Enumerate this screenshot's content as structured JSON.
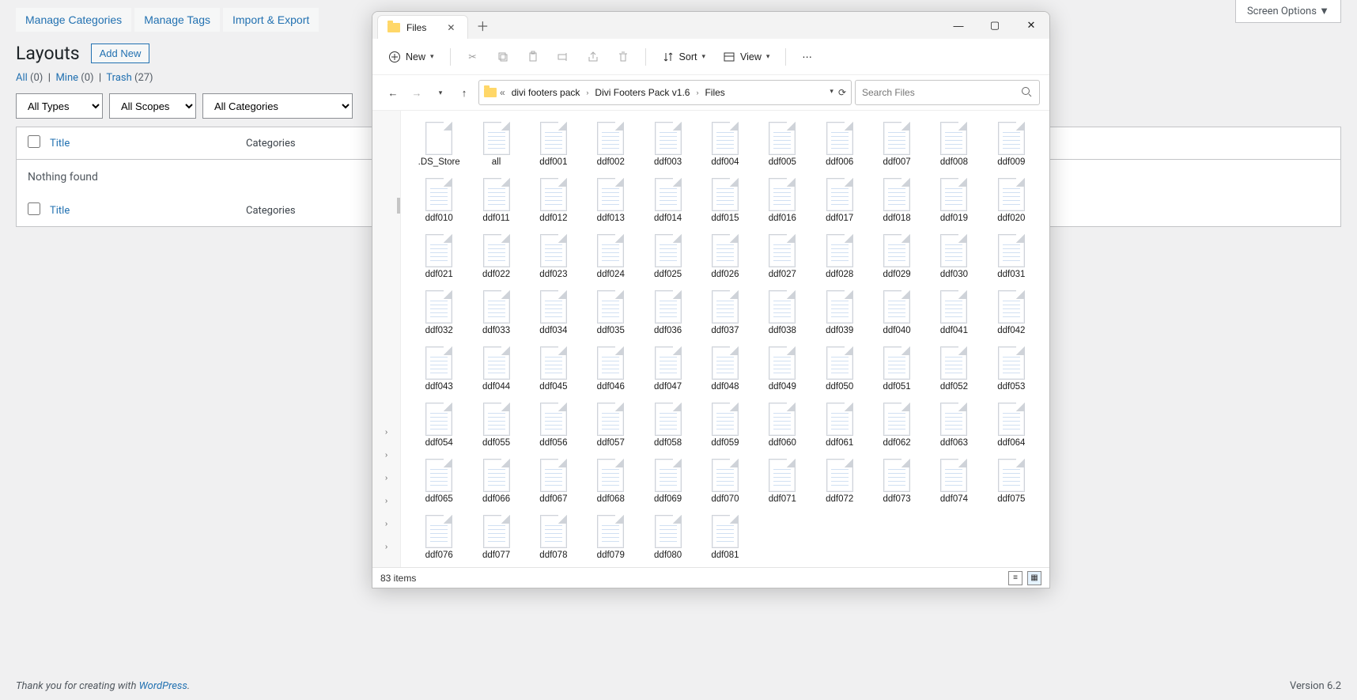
{
  "wp": {
    "screen_options": "Screen Options  ▼",
    "top_links": {
      "manage_categories": "Manage Categories",
      "manage_tags": "Manage Tags",
      "import_export": "Import & Export"
    },
    "page_title": "Layouts",
    "add_new": "Add New",
    "filters": {
      "all": "All",
      "all_count": "(0)",
      "mine": "Mine",
      "mine_count": "(0)",
      "trash": "Trash",
      "trash_count": "(27)"
    },
    "selects": {
      "types": "All Types",
      "scopes": "All Scopes",
      "categories": "All Categories"
    },
    "columns": {
      "title": "Title",
      "categories": "Categories"
    },
    "empty": "Nothing found",
    "footer_pre": "Thank you for creating with ",
    "footer_wp": "WordPress",
    "version": "Version 6.2"
  },
  "explorer": {
    "tab_title": "Files",
    "toolbar": {
      "new": "New",
      "sort": "Sort",
      "view": "View"
    },
    "breadcrumb": {
      "p1": "divi footers pack",
      "p2": "Divi Footers Pack v1.6",
      "p3": "Files"
    },
    "search_placeholder": "Search Files",
    "status": "83 items",
    "leading_files": [
      ".DS_Store",
      "all"
    ],
    "file_prefix": "ddf",
    "file_range": [
      1,
      81
    ]
  }
}
